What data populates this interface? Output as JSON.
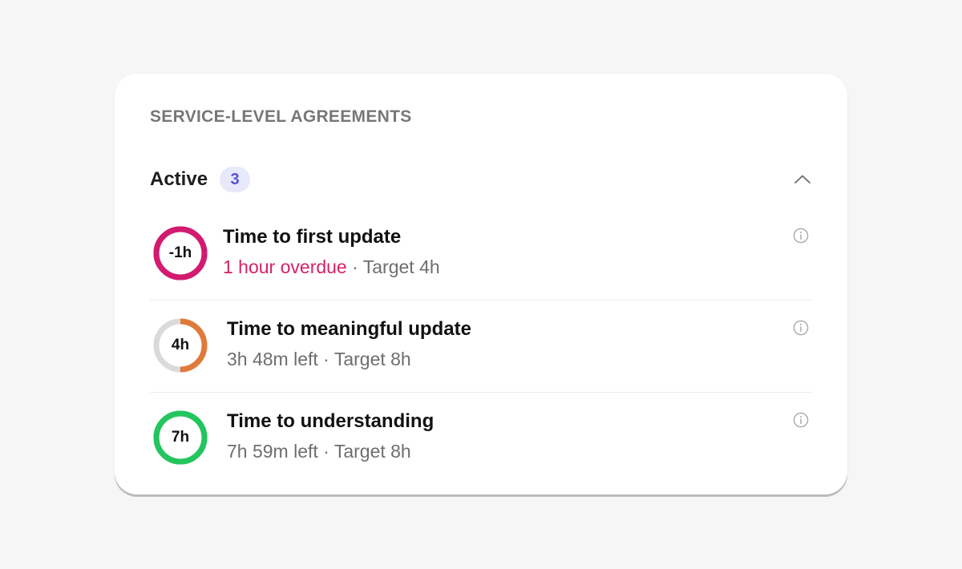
{
  "card": {
    "title": "SERVICE-LEVEL AGREEMENTS"
  },
  "section": {
    "label": "Active",
    "count": "3",
    "collapse_icon": "chevron-up-icon"
  },
  "slas": [
    {
      "ring_label": "-1h",
      "ring_color": "#d21a6f",
      "ring_track": "#d21a6f",
      "progress": 1.0,
      "title": "Time to first update",
      "status": "1 hour overdue",
      "status_color": "#d62168",
      "separator": " · ",
      "target": "Target 4h",
      "info_icon": "info-icon"
    },
    {
      "ring_label": "4h",
      "ring_color": "#e07a3a",
      "ring_track": "#dadada",
      "progress": 0.5,
      "title": "Time to meaningful update",
      "status": "3h 48m left",
      "status_color": "#6e6e6e",
      "separator": " · ",
      "target": "Target 8h",
      "info_icon": "info-icon"
    },
    {
      "ring_label": "7h",
      "ring_color": "#22c55e",
      "ring_track": "#22c55e",
      "progress": 1.0,
      "title": "Time to understanding",
      "status": "7h 59m left",
      "status_color": "#6e6e6e",
      "separator": " · ",
      "target": "Target 8h",
      "info_icon": "info-icon"
    }
  ]
}
